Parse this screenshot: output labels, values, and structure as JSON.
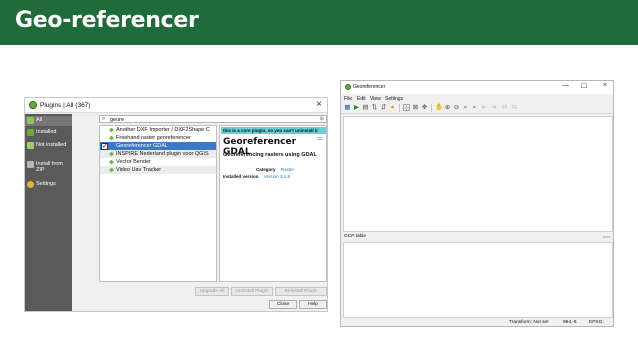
{
  "banner": {
    "title": "Geo-referencer",
    "color": "#1f6b3a"
  },
  "plugins_dialog": {
    "title": "Plugins | All (367)",
    "close_icon": "×",
    "sidebar": [
      {
        "label": "All",
        "icon": "plugin-icon",
        "active": true
      },
      {
        "label": "Installed",
        "icon": "installed-icon"
      },
      {
        "label": "Not installed",
        "icon": "not-installed-icon"
      },
      {
        "label": "Install from ZIP",
        "icon": "zip-icon"
      },
      {
        "label": "Settings",
        "icon": "gear-icon"
      }
    ],
    "search": {
      "value": "geore",
      "icon": "search-icon"
    },
    "list": [
      {
        "label": "Another DXF Importer / DXF2Shape C"
      },
      {
        "label": "Freehand raster georeferencer"
      },
      {
        "label": "Georeferencer GDAL",
        "selected": true,
        "checked": true
      },
      {
        "label": "INSPIRE Nederland plugin voor QGIS"
      },
      {
        "label": "Vector Bender"
      },
      {
        "label": "Video Uav Tracker"
      }
    ],
    "detail": {
      "notice": "this is a core plugin, so you can't uninstall it",
      "title": "Georeferencer GDAL",
      "subtitle": "Georeferencing rasters using GDAL",
      "category_label": "Category",
      "category_value": "Raster",
      "version_label": "Installed version",
      "version_value": "Version 3.1.9"
    },
    "buttons": {
      "upgrade_all": "Upgrade All",
      "uninstall": "Uninstall Plugin",
      "reinstall": "Reinstall Plugin",
      "close": "Close",
      "help": "Help"
    }
  },
  "georeferencer": {
    "title": "Georeferencer",
    "window_controls": {
      "minimize": "—",
      "maximize": "☐",
      "close": "×"
    },
    "menu": [
      "File",
      "Edit",
      "View",
      "Settings"
    ],
    "gcp_table_label": "GCP table",
    "status": {
      "transform": "Transform: Not set",
      "coords": "964,-6",
      "epsg": "EPSG:"
    }
  }
}
